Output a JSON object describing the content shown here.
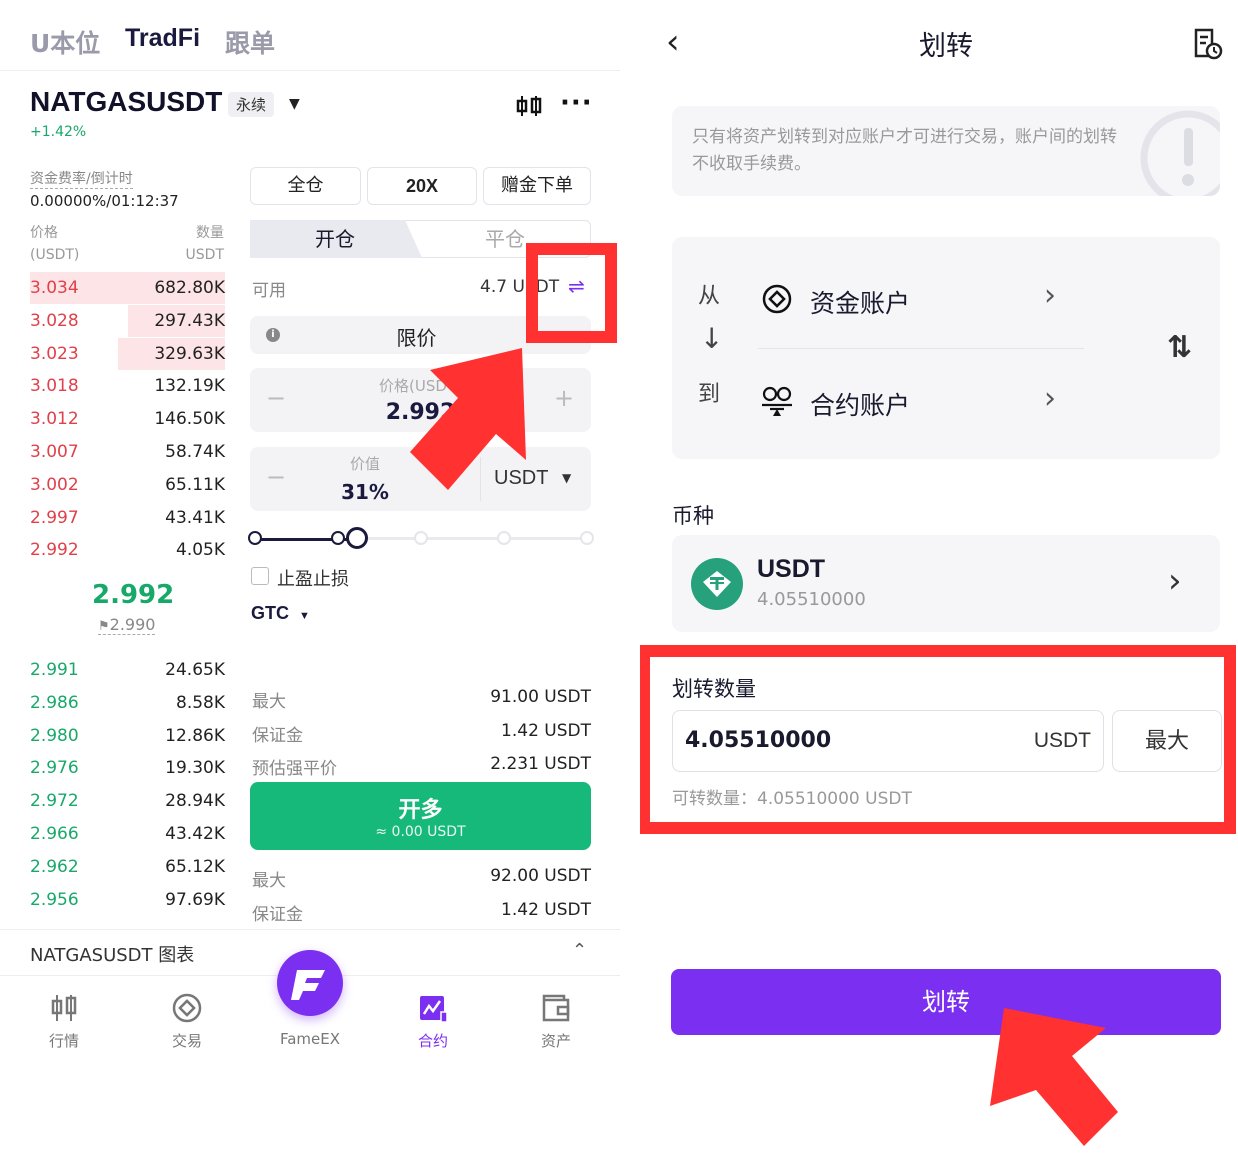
{
  "left": {
    "tabs": [
      "U本位",
      "TradFi",
      "跟单"
    ],
    "active_tab": 1,
    "symbol": "NATGASUSDT",
    "contract_tag": "永续",
    "change": "+1.42%",
    "funding_label": "资金费率/倒计时",
    "funding_value": "0.00000%/01:12:37",
    "ob_head_price": "价格",
    "ob_head_price_unit": "(USDT)",
    "ob_head_qty": "数量",
    "ob_head_qty_unit": "USDT",
    "asks": [
      {
        "price": "3.034",
        "qty": "682.80K",
        "depth": 1.0
      },
      {
        "price": "3.028",
        "qty": "297.43K",
        "depth": 0.5
      },
      {
        "price": "3.023",
        "qty": "329.63K",
        "depth": 0.55
      },
      {
        "price": "3.018",
        "qty": "132.19K",
        "depth": 0.0
      },
      {
        "price": "3.012",
        "qty": "146.50K",
        "depth": 0.0
      },
      {
        "price": "3.007",
        "qty": "58.74K",
        "depth": 0.0
      },
      {
        "price": "3.002",
        "qty": "65.11K",
        "depth": 0.0
      },
      {
        "price": "2.997",
        "qty": "43.41K",
        "depth": 0.0
      },
      {
        "price": "2.992",
        "qty": "4.05K",
        "depth": 0.0
      }
    ],
    "mid_price": "2.992",
    "mark_price": "2.990",
    "bids": [
      {
        "price": "2.991",
        "qty": "24.65K",
        "depth": 0.0
      },
      {
        "price": "2.986",
        "qty": "8.58K",
        "depth": 0.0
      },
      {
        "price": "2.980",
        "qty": "12.86K",
        "depth": 0.0
      },
      {
        "price": "2.976",
        "qty": "19.30K",
        "depth": 0.0
      },
      {
        "price": "2.972",
        "qty": "28.94K",
        "depth": 0.0
      },
      {
        "price": "2.966",
        "qty": "43.42K",
        "depth": 0.0
      },
      {
        "price": "2.962",
        "qty": "65.12K",
        "depth": 0.0
      },
      {
        "price": "2.956",
        "qty": "97.69K",
        "depth": 0.0
      }
    ],
    "margin_mode": "全仓",
    "leverage": "20X",
    "bonus_order": "赠金下单",
    "open_tab": "开仓",
    "close_tab": "平仓",
    "available_label": "可用",
    "available_value": "4.7 USDT",
    "order_type": "限价",
    "price_placeholder": "价格(USDT)",
    "price_value": "2.992",
    "value_label": "价值",
    "value_pct": "31%",
    "value_unit": "USDT",
    "tpsl_label": "止盈止损",
    "tif": "GTC",
    "long_stats": [
      {
        "label": "最大",
        "value": "91.00 USDT"
      },
      {
        "label": "保证金",
        "value": "1.42 USDT"
      },
      {
        "label": "预估强平价",
        "value": "2.231 USDT"
      }
    ],
    "buy_label": "开多",
    "buy_sub": "≈ 0.00 USDT",
    "short_stats": [
      {
        "label": "最大",
        "value": "92.00 USDT"
      },
      {
        "label": "保证金",
        "value": "1.42 USDT"
      }
    ],
    "chart_bar_label": "NATGASUSDT 图表",
    "nav": [
      "行情",
      "交易",
      "FameEX",
      "合约",
      "资产"
    ],
    "nav_active": 3
  },
  "right": {
    "title": "划转",
    "notice": "只有将资产划转到对应账户才可进行交易，账户间的划转不收取手续费。",
    "from_label": "从",
    "to_label": "到",
    "from_account": "资金账户",
    "to_account": "合约账户",
    "coin_section": "币种",
    "coin_name": "USDT",
    "coin_balance": "4.05510000",
    "amount_section": "划转数量",
    "amount_value": "4.05510000",
    "amount_unit": "USDT",
    "max_button": "最大",
    "transferable": "可转数量：4.05510000 USDT",
    "transfer_button": "划转"
  },
  "colors": {
    "accent": "#7b2ff0",
    "buy": "#16b97a",
    "sell": "#e0404a",
    "highlight": "#ff3131"
  }
}
